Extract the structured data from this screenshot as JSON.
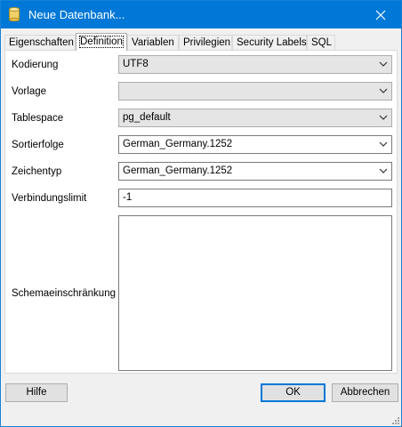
{
  "window": {
    "title": "Neue Datenbank..."
  },
  "tabs": [
    {
      "label": "Eigenschaften"
    },
    {
      "label": "Definition"
    },
    {
      "label": "Variablen"
    },
    {
      "label": "Privilegien"
    },
    {
      "label": "Security Labels"
    },
    {
      "label": "SQL"
    }
  ],
  "active_tab": "Definition",
  "form": {
    "encoding": {
      "label": "Kodierung",
      "value": "UTF8"
    },
    "template": {
      "label": "Vorlage",
      "value": ""
    },
    "tablespace": {
      "label": "Tablespace",
      "value": "pg_default"
    },
    "collation": {
      "label": "Sortierfolge",
      "value": "German_Germany.1252"
    },
    "ctype": {
      "label": "Zeichentyp",
      "value": "German_Germany.1252"
    },
    "connlimit": {
      "label": "Verbindungslimit",
      "value": "-1"
    },
    "schema_restriction": {
      "label": "Schemaeinschränkung",
      "value": ""
    }
  },
  "buttons": {
    "help": "Hilfe",
    "ok": "OK",
    "cancel": "Abbrechen"
  },
  "colors": {
    "titlebar": "#0078d7",
    "panel": "#ffffff",
    "dialog": "#f0f0f0"
  },
  "icons": {
    "title": "database-cylinder-icon",
    "close": "close-icon",
    "dropdown": "chevron-down-icon",
    "resize": "resize-grip-icon"
  }
}
